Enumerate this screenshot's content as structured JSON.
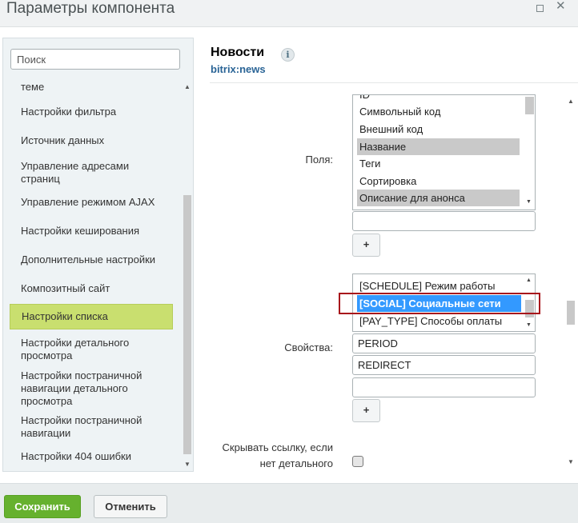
{
  "window": {
    "title": "Параметры компонента",
    "icons": [
      "maximize-icon",
      "close-icon"
    ]
  },
  "sidebar": {
    "search_placeholder": "Поиск",
    "items": [
      {
        "label": "теме"
      },
      {
        "label": "Настройки фильтра"
      },
      {
        "label": "Источник данных"
      },
      {
        "label": "Управление адресами страниц"
      },
      {
        "label": "Управление режимом AJAX"
      },
      {
        "label": "Настройки кеширования"
      },
      {
        "label": "Дополнительные настройки"
      },
      {
        "label": "Композитный сайт"
      },
      {
        "label": "Настройки списка",
        "active": true
      },
      {
        "label": "Настройки детального просмотра"
      },
      {
        "label": "Настройки постраничной навигации детального просмотра"
      },
      {
        "label": "Настройки постраничной навигации"
      },
      {
        "label": "Настройки 404 ошибки"
      }
    ]
  },
  "component": {
    "title": "Новости",
    "code": "bitrix:news",
    "info_icon": "info-icon"
  },
  "fields": {
    "label": "Поля:",
    "options": [
      {
        "label": "ID",
        "selected": false
      },
      {
        "label": "Символьный код",
        "selected": false
      },
      {
        "label": "Внешний код",
        "selected": false
      },
      {
        "label": "Название",
        "selected": true
      },
      {
        "label": "Теги",
        "selected": false
      },
      {
        "label": "Сортировка",
        "selected": false
      },
      {
        "label": "Описание для анонса",
        "selected": true
      }
    ],
    "extra_input_value": "",
    "add_label": "+"
  },
  "properties": {
    "label": "Свойства:",
    "options": [
      {
        "label": "[SCHEDULE] Режим работы",
        "selected": false
      },
      {
        "label": "[SOCIAL] Социальные сети",
        "selected": true
      },
      {
        "label": "[PAY_TYPE] Способы оплаты",
        "selected": false
      }
    ],
    "inputs": [
      "PERIOD",
      "REDIRECT",
      ""
    ],
    "add_label": "+"
  },
  "hide_link": {
    "label_line1": "Скрывать ссылку, если",
    "label_line2": "нет детального",
    "checked": false
  },
  "footer": {
    "save_label": "Сохранить",
    "cancel_label": "Отменить"
  },
  "colors": {
    "accent_green": "#66b12e",
    "active_menu": "#c9df6f",
    "selection_blue": "#3399ff",
    "highlight_red": "#a8161b",
    "code_blue": "#2a6496"
  }
}
